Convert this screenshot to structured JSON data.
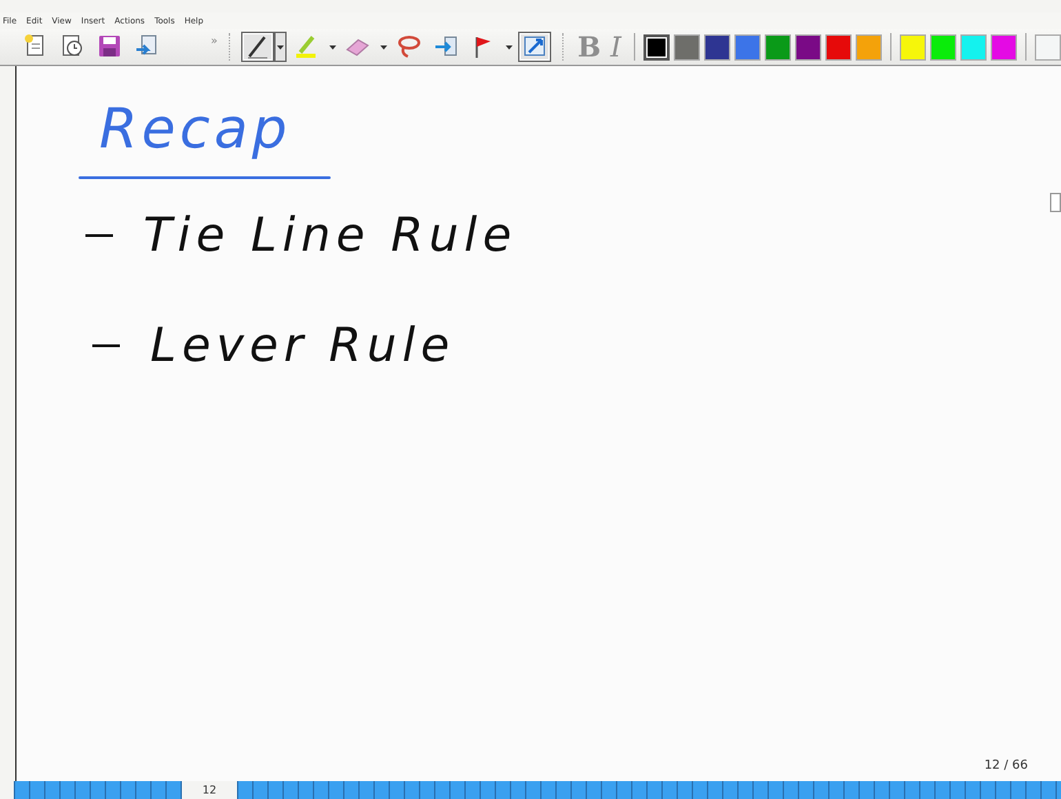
{
  "menu": [
    "File",
    "Edit",
    "View",
    "Insert",
    "Actions",
    "Tools",
    "Help"
  ],
  "toolbar": {
    "file_tools": [
      {
        "kind": "new"
      },
      {
        "kind": "recent"
      },
      {
        "kind": "save"
      },
      {
        "kind": "share"
      }
    ],
    "overflow": "»",
    "tools": [
      {
        "kind": "pen",
        "selected": true,
        "dropdown": true
      },
      {
        "kind": "highlighter",
        "selected": false,
        "dropdown": true
      },
      {
        "kind": "eraser",
        "selected": false,
        "dropdown": true
      },
      {
        "kind": "lasso",
        "selected": false,
        "dropdown": false
      },
      {
        "kind": "insert-space",
        "selected": false,
        "dropdown": false
      },
      {
        "kind": "flag",
        "selected": false,
        "dropdown": true
      },
      {
        "kind": "select",
        "selected": true,
        "dropdown": false
      }
    ],
    "format": [
      {
        "label": "B",
        "disabled": true
      },
      {
        "label": "I",
        "disabled": true
      }
    ],
    "colors": [
      {
        "color": "#000000",
        "selected": true
      },
      {
        "color": "#6e6e6a",
        "selected": false
      },
      {
        "color": "#2e3592",
        "selected": false
      },
      {
        "color": "#3c74e8",
        "selected": false
      },
      {
        "color": "#0a9a18",
        "selected": false
      },
      {
        "color": "#7a0a86",
        "selected": false
      },
      {
        "color": "#e60a0a",
        "selected": false
      },
      {
        "color": "#f4a20a",
        "selected": false
      },
      {
        "color": "#f6f60a",
        "selected": false
      },
      {
        "color": "#0aec0a",
        "selected": false
      },
      {
        "color": "#14f2ee",
        "selected": false
      },
      {
        "color": "#e40ae4",
        "selected": false
      },
      {
        "color": "#f4f6f6",
        "selected": false
      }
    ]
  },
  "note": {
    "title": "Recap",
    "items": [
      "Tie Line Rule",
      "Lever Rule"
    ]
  },
  "page_indicator": "12 / 66",
  "page_strip": {
    "current": "12"
  }
}
